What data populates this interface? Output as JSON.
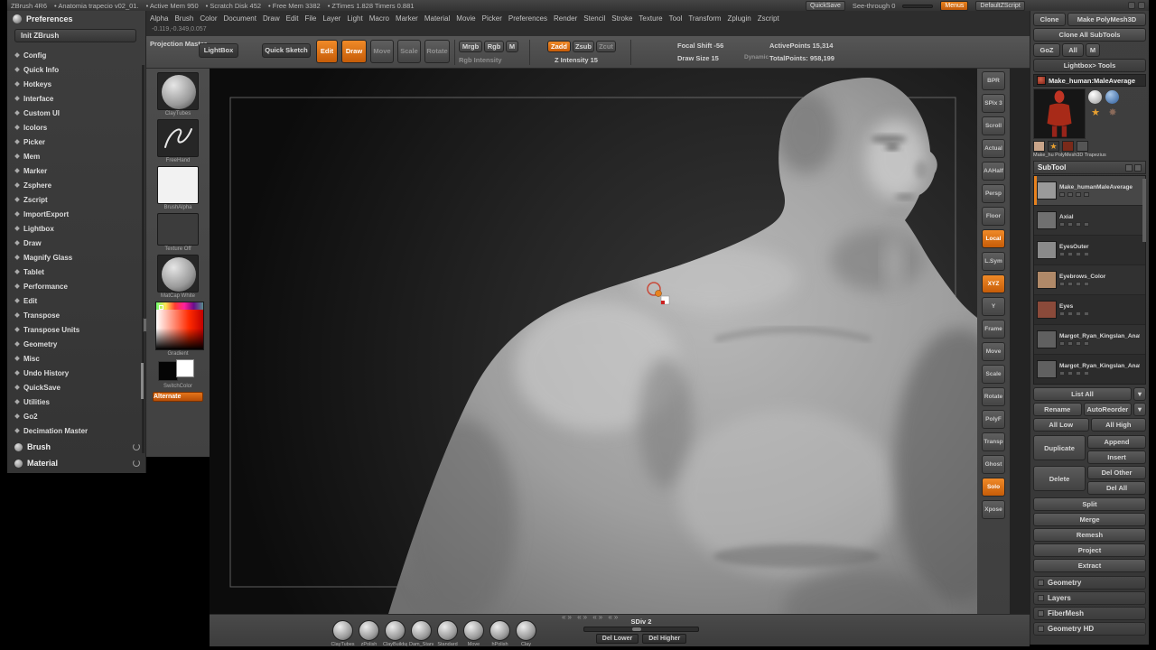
{
  "accent": {
    "orange": "#e8821e"
  },
  "glyphs": {
    "down_arrow": "▼",
    "dropdown": "▾"
  },
  "title_bar": {
    "app": "ZBrush 4R6",
    "document": "• Anatomia trapecio v02_01.",
    "active_mem": "• Active Mem 950",
    "scratch_disk": "• Scratch Disk 452",
    "free_mem": "• Free Mem 3382",
    "ztimes": "• ZTimes 1.828 Timers 0.881",
    "quicksave": "QuickSave",
    "see_through": "See-through 0",
    "menus": "Menus",
    "default_zscript": "DefaultZScript"
  },
  "menu_bar": {
    "items": [
      "Alpha",
      "Brush",
      "Color",
      "Document",
      "Draw",
      "Edit",
      "File",
      "Layer",
      "Light",
      "Macro",
      "Marker",
      "Material",
      "Movie",
      "Picker",
      "Preferences",
      "Render",
      "Stencil",
      "Stroke",
      "Texture",
      "Tool",
      "Transform",
      "Zplugin",
      "Zscript"
    ]
  },
  "status": {
    "coordinates": "-0.119,-0.349,0.057"
  },
  "top_shelf": {
    "projection_master": "Projection Master",
    "lightbox": "LightBox",
    "quick_sketch": "Quick Sketch",
    "edit": "Edit",
    "draw": "Draw",
    "move": "Move",
    "scale": "Scale",
    "rotate": "Rotate",
    "mrgb": "Mrgb",
    "rgb": "Rgb",
    "m": "M",
    "rgb_intensity": "Rgb Intensity",
    "zadd": "Zadd",
    "zsub": "Zsub",
    "zcut": "Zcut",
    "z_intensity": "Z Intensity 15",
    "focal_shift": "Focal Shift -56",
    "draw_size": "Draw Size 15",
    "dynamic": "Dynamic",
    "active_points": "ActivePoints 15,314",
    "total_points": "TotalPoints: 958,199"
  },
  "preferences_panel": {
    "title": "Preferences",
    "init_button": "Init ZBrush",
    "items": [
      "Config",
      "Quick Info",
      "Hotkeys",
      "Interface",
      "Custom UI",
      "Icolors",
      "Picker",
      "Mem",
      "Marker",
      "Zsphere",
      "Zscript",
      "ImportExport",
      "Lightbox",
      "Draw",
      "Magnify Glass",
      "Tablet",
      "Performance",
      "Edit",
      "Transpose",
      "Transpose Units",
      "Geometry",
      "Misc",
      "Undo History",
      "QuickSave",
      "Utilities",
      "Go2",
      "Decimation Master"
    ],
    "brush_header": "Brush",
    "material_header": "Material"
  },
  "left_tray": {
    "brush_label": "ClayTubes",
    "stroke_label": "FreeHand",
    "alpha_label": "BrushAlpha",
    "texture_label": "Texture Off",
    "material_label": "MatCap White",
    "gradient_label": "Gradient",
    "switch_label": "SwitchColor",
    "alternate_label": "Alternate"
  },
  "right_shelf": {
    "items": [
      {
        "label": "BPR"
      },
      {
        "label": "SPix 3"
      },
      {
        "label": "Scroll"
      },
      {
        "label": "Actual"
      },
      {
        "label": "AAHalf"
      },
      {
        "label": "Persp"
      },
      {
        "label": "Floor"
      },
      {
        "label": "Local",
        "active": true
      },
      {
        "label": "L.Sym"
      },
      {
        "label": "XYZ",
        "active": true
      },
      {
        "label": "Y"
      },
      {
        "label": "Frame"
      },
      {
        "label": "Move"
      },
      {
        "label": "Scale"
      },
      {
        "label": "Rotate"
      },
      {
        "label": "PolyF"
      },
      {
        "label": "Transp"
      },
      {
        "label": "Ghost"
      },
      {
        "label": "Solo",
        "active": true
      },
      {
        "label": "Xpose"
      }
    ]
  },
  "tool_panel": {
    "clone": "Clone",
    "make_polymesh": "Make PolyMesh3D",
    "clone_all": "Clone All SubTools",
    "goz": "GoZ",
    "all": "All",
    "m": "M",
    "lightbox_tools": "Lightbox> Tools",
    "current_tool": "Make_human:MaleAverage",
    "quick_pick_caption": "Make_hu  PolyMesh3D  Trapezius",
    "subtool": {
      "header": "SubTool",
      "items": [
        {
          "name": "Make_humanMaleAverage",
          "selected": true,
          "thumb": "#9a9a9a"
        },
        {
          "name": "Axial",
          "thumb": "#707070"
        },
        {
          "name": "EyesOuter",
          "thumb": "#8a8a8a"
        },
        {
          "name": "Eyebrows_Color",
          "thumb": "#b08968"
        },
        {
          "name": "Eyes",
          "thumb": "#8a4a3a"
        },
        {
          "name": "Margot_Ryan_Kingslan_Anatomy",
          "thumb": "#606060"
        },
        {
          "name": "Margot_Ryan_Kingslan_Anatomy_",
          "thumb": "#606060"
        }
      ],
      "list_all": "List All",
      "rename": "Rename",
      "autoreorder": "AutoReorder",
      "all_low": "All Low",
      "all_high": "All High",
      "duplicate": "Duplicate",
      "append": "Append",
      "insert": "Insert",
      "delete": "Delete",
      "del_other": "Del Other",
      "del_all": "Del All",
      "groups": [
        "Split",
        "Merge",
        "Remesh",
        "Project",
        "Extract"
      ]
    },
    "sections": [
      "Geometry",
      "Layers",
      "FiberMesh",
      "Geometry HD"
    ]
  },
  "bottom_bar": {
    "chevrons": "«»  «»  «»  «»",
    "brushes": [
      "ClayTubes",
      "zPolish",
      "ClayBuildup",
      "Dam_Standard",
      "Standard",
      "Move",
      "hPolish",
      "Clay"
    ],
    "sdiv": "SDiv 2",
    "del_lower": "Del Lower",
    "del_higher": "Del Higher"
  }
}
